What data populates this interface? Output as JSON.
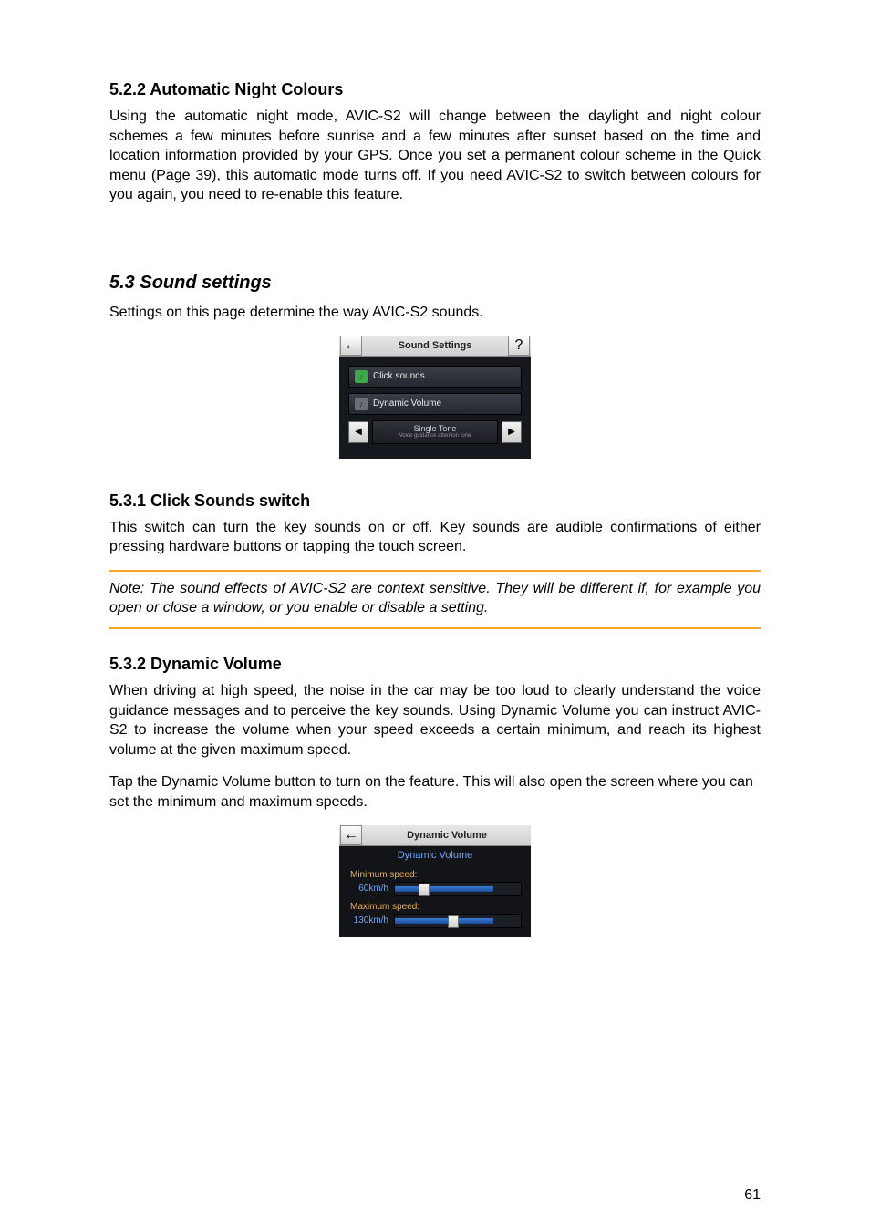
{
  "section_522": {
    "heading": "5.2.2  Automatic Night Colours",
    "body": "Using the automatic night mode, AVIC-S2 will change between the daylight and night colour schemes a few minutes before sunrise and a few minutes after sunset based on the time and location information provided by your GPS. Once you set a permanent colour scheme in the Quick menu (Page 39), this automatic mode turns off. If you need AVIC-S2 to switch between colours for you again, you need to re-enable this feature."
  },
  "section_53": {
    "heading": "5.3  Sound settings",
    "intro": "Settings on this page determine the way AVIC-S2 sounds."
  },
  "sound_screenshot": {
    "title": "Sound Settings",
    "help": "?",
    "back": "←",
    "row_click": "Click sounds",
    "row_dynamic": "Dynamic Volume",
    "tone_main": "Single Tone",
    "tone_sub": "Voice guidance attention tone",
    "left_arrow": "◀",
    "right_arrow": "▶"
  },
  "section_531": {
    "heading": "5.3.1  Click Sounds switch",
    "body": "This switch can turn the key sounds on or off. Key sounds are audible confirmations of either pressing hardware buttons or tapping the touch screen.",
    "note": "Note: The sound effects of AVIC-S2 are context sensitive. They will be different if, for example you open or close a window, or you enable or disable a setting."
  },
  "section_532": {
    "heading": "5.3.2  Dynamic Volume",
    "body1": "When driving at high speed, the noise in the car may be too loud to clearly understand the voice guidance messages and to perceive the key sounds. Using Dynamic Volume you can instruct AVIC-S2 to increase the volume when your speed exceeds a certain minimum, and reach its highest volume at the given maximum speed.",
    "body2": "Tap the Dynamic Volume button to turn on the feature. This will also open the screen where you can set the minimum and maximum speeds."
  },
  "dyn_screenshot": {
    "title": "Dynamic Volume",
    "back": "←",
    "sub": "Dynamic Volume",
    "min_label": "Minimum speed:",
    "min_value": "60km/h",
    "max_label": "Maximum speed:",
    "max_value": "130km/h"
  },
  "page_number": "61"
}
